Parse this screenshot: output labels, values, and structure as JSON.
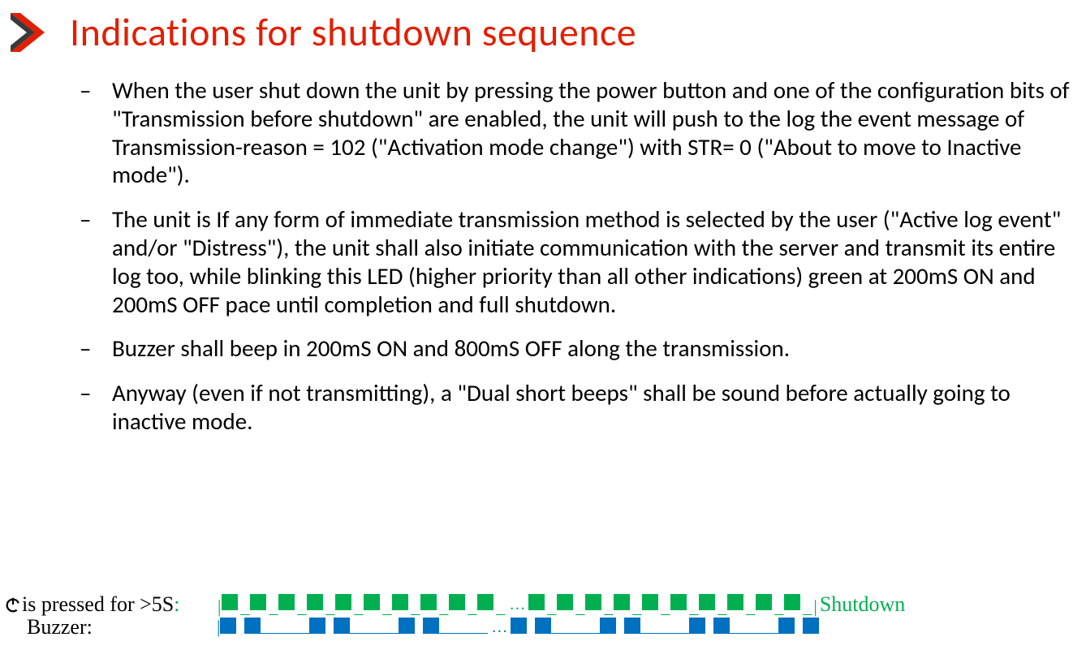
{
  "title": "Indications for shutdown sequence",
  "bullets": [
    "When the user shut down the unit by pressing the power button and one of the configuration bits of \"Transmission before shutdown\" are enabled, the unit will push to the log the event message of Transmission-reason = 102 (\"Activation mode change\") with STR= 0 (\"About to move to Inactive mode\").",
    "The unit is If any form of immediate transmission method is selected by the user (\"Active log event\" and/or \"Distress\"), the unit shall also initiate communication with the server and transmit its entire log too, while blinking this LED (higher priority than all other indications) green at 200mS ON and 200mS OFF pace until completion and full shutdown.",
    "Buzzer shall beep in 200mS ON and 800mS OFF along the transmission.",
    "Anyway (even if not transmitting), a \"Dual short beeps\" shall be sound before actually going to inactive mode."
  ],
  "footer": {
    "press_label": " is pressed for >5S",
    "buzzer_label": "Buzzer:",
    "shutdown_label": "Shutdown",
    "colon": ":",
    "ellipsis": "…",
    "pipe": "|",
    "led_timing": {
      "on_ms": 200,
      "off_ms": 200,
      "blocks_before_ellipsis": 10,
      "blocks_after_ellipsis": 10,
      "color": "#00b050"
    },
    "buzzer_timing": {
      "on_ms": 200,
      "off_ms": 800,
      "segments_before_ellipsis": 3,
      "segments_after_ellipsis": 4,
      "color": "#0070c0"
    }
  },
  "colors": {
    "title_red": "#e31e00",
    "green": "#00b050",
    "blue": "#0070c0",
    "logo_dark": "#3a3a3a"
  }
}
